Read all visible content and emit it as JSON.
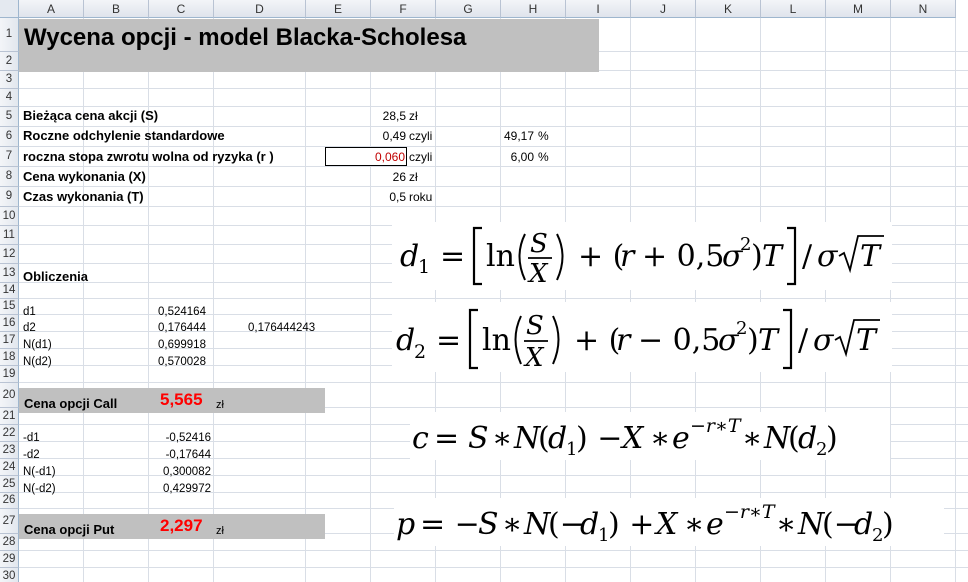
{
  "columns": [
    "A",
    "B",
    "C",
    "D",
    "E",
    "F",
    "G",
    "H",
    "I",
    "J",
    "K",
    "L",
    "M",
    "N"
  ],
  "rows": [
    "1",
    "2",
    "3",
    "4",
    "5",
    "6",
    "7",
    "8",
    "9",
    "10",
    "11",
    "12",
    "13",
    "14",
    "15",
    "16",
    "17",
    "18",
    "19",
    "20",
    "21",
    "22",
    "23",
    "24",
    "25",
    "26",
    "27",
    "28",
    "29",
    "30"
  ],
  "title": "Wycena opcji - model Blacka-Scholesa",
  "inputs": [
    {
      "label": "Bieżąca cena akcji (S)",
      "value": "28,5",
      "unit": "zł",
      "extra": "",
      "extra_unit": ""
    },
    {
      "label": "Roczne odchylenie standardowe",
      "value": "0,49",
      "unit": "czyli",
      "extra": "49,17",
      "extra_unit": "%"
    },
    {
      "label": "roczna stopa zwrotu wolna od ryzyka (r )",
      "value": "0,060",
      "unit": "czyli",
      "extra": "6,00",
      "extra_unit": "%"
    },
    {
      "label": "Cena wykonania (X)",
      "value": "26",
      "unit": "zł",
      "extra": "",
      "extra_unit": ""
    },
    {
      "label": "Czas wykonania (T)",
      "value": "0,5",
      "unit": "roku",
      "extra": "",
      "extra_unit": ""
    }
  ],
  "calc_heading": "Obliczenia",
  "calc_rows": [
    {
      "label": "d1",
      "value": "0,524164",
      "extra": ""
    },
    {
      "label": "d2",
      "value": "0,176444",
      "extra": "0,176444243"
    },
    {
      "label": "N(d1)",
      "value": "0,699918",
      "extra": ""
    },
    {
      "label": "N(d2)",
      "value": "0,570028",
      "extra": ""
    }
  ],
  "call": {
    "label": "Cena opcji Call",
    "value": "5,565",
    "unit": "zł"
  },
  "neg_rows": [
    {
      "label": "-d1",
      "value": "-0,52416"
    },
    {
      "label": "-d2",
      "value": "-0,17644"
    },
    {
      "label": "N(-d1)",
      "value": "0,300082"
    },
    {
      "label": "N(-d2)",
      "value": "0,429972"
    }
  ],
  "put": {
    "label": "Cena opcji Put",
    "value": "2,297",
    "unit": "zł"
  },
  "formulas": {
    "d1": "d1 = [ln(S/X) + (r + 0,5σ²)T] / σ√T",
    "d2": "d2 = [ln(S/X) + (r − 0,5σ²)T] / σ√T",
    "call": "c = S * N(d1) − X * e^(−r*T) * N(d2)",
    "put": "p = −S * N(−d1) + X * e^(−r*T) * N(−d2)"
  }
}
